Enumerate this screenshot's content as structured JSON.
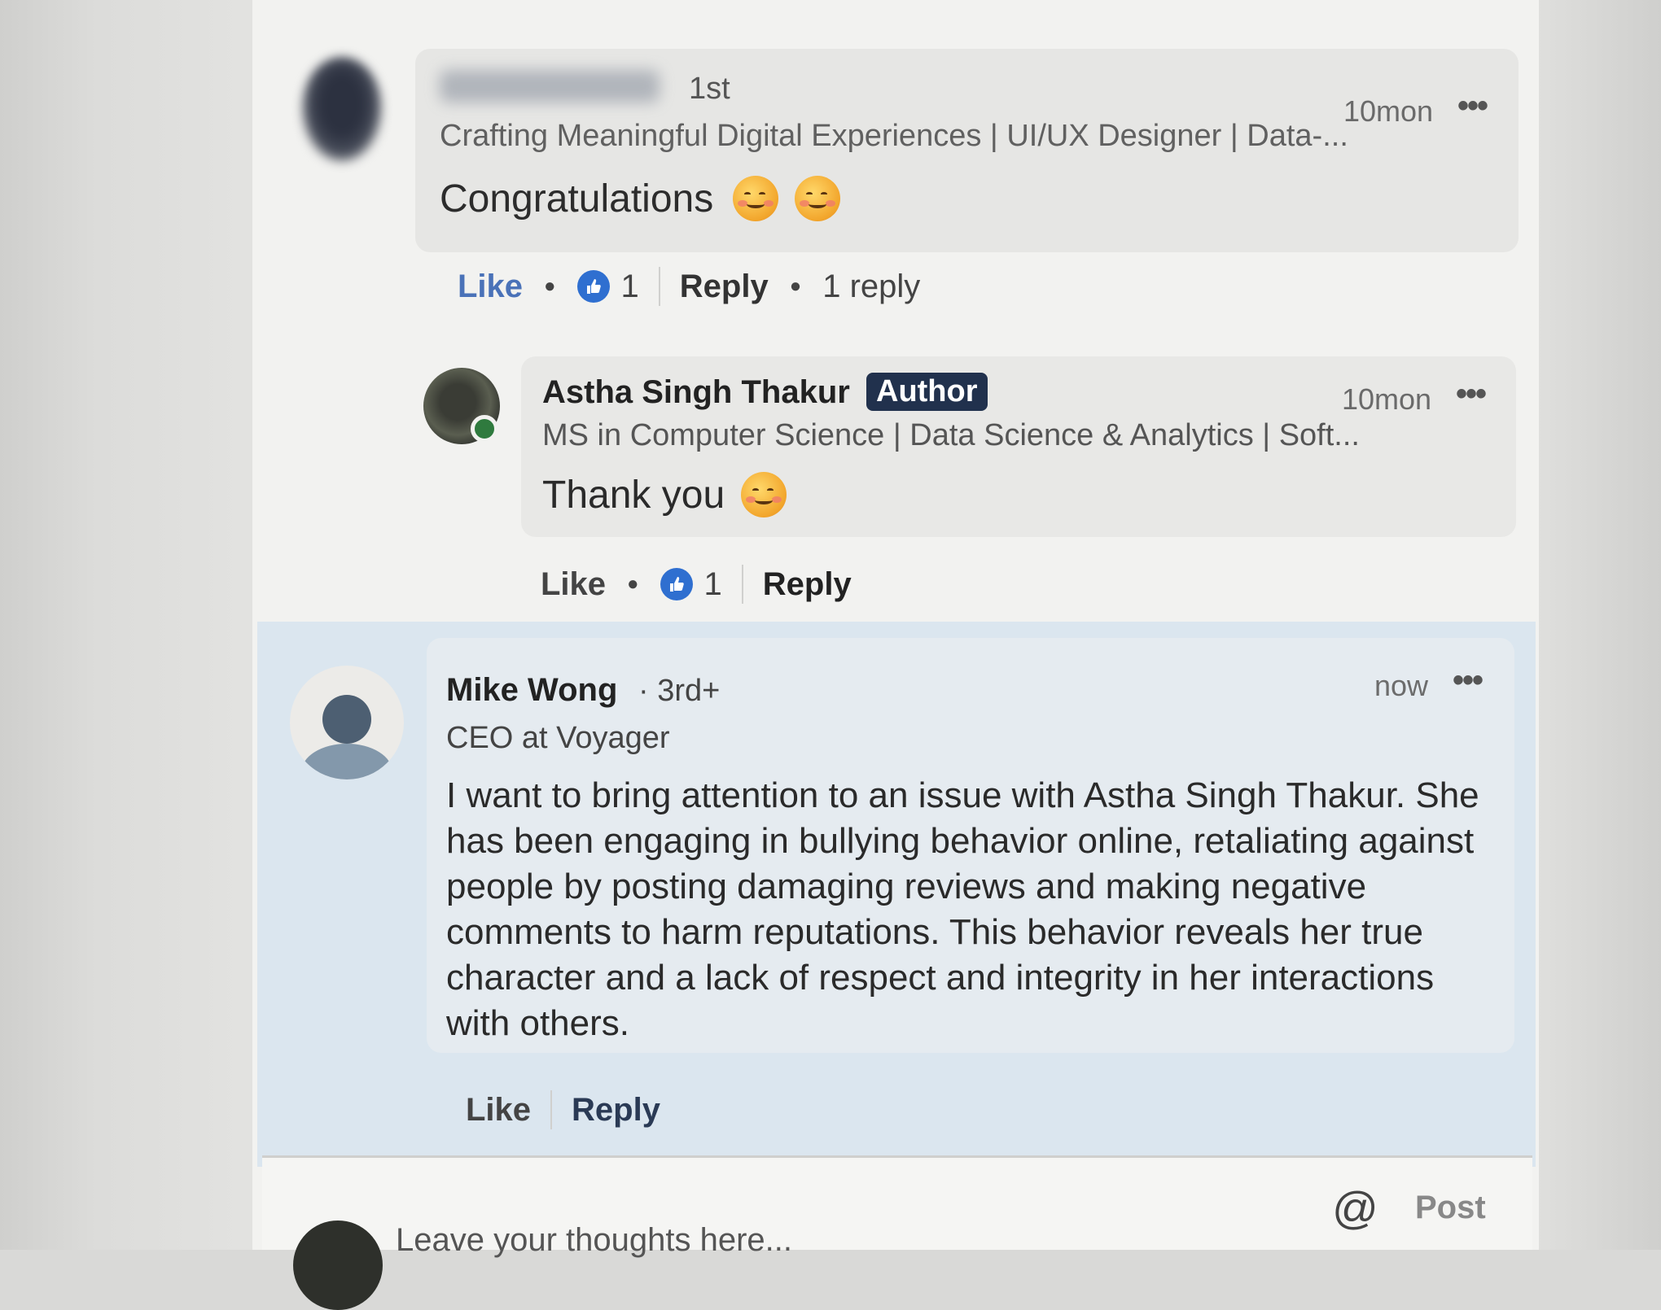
{
  "comment_1": {
    "author_name": "",
    "degree": "1st",
    "headline": "Crafting Meaningful Digital Experiences | UI/UX Designer | Data-...",
    "text": "Congratulations",
    "emojis": [
      "partying-face-icon",
      "partying-face-icon"
    ],
    "time": "10mon",
    "more": "•••",
    "actions": {
      "like": "Like",
      "reaction_count": "1",
      "reply": "Reply",
      "replies": "1 reply"
    }
  },
  "reply_1": {
    "author_name": "Astha Singh Thakur",
    "badge": "Author",
    "headline": "MS in Computer Science | Data Science & Analytics | Soft...",
    "text": "Thank you",
    "emoji": "smiling-face-icon",
    "time": "10mon",
    "more": "•••",
    "actions": {
      "like": "Like",
      "reaction_count": "1",
      "reply": "Reply"
    }
  },
  "comment_2": {
    "author_name": "Mike Wong",
    "degree": "· 3rd+",
    "headline": "CEO at Voyager",
    "text": "I want to bring attention to an issue with Astha Singh Thakur. She has been engaging in bullying behavior online, retaliating against people by posting damaging reviews and making negative comments to harm reputations. This behavior reveals her true character and a lack of respect and integrity in her interactions with others.",
    "time": "now",
    "more": "•••",
    "actions": {
      "like": "Like",
      "reply": "Reply"
    }
  },
  "composer": {
    "placeholder": "Leave your thoughts here...",
    "mention": "@",
    "post": "Post"
  },
  "colors": {
    "highlight_bg": "#dbe6ef",
    "badge_bg": "#21314d",
    "like_blue": "#2f6fd0"
  }
}
